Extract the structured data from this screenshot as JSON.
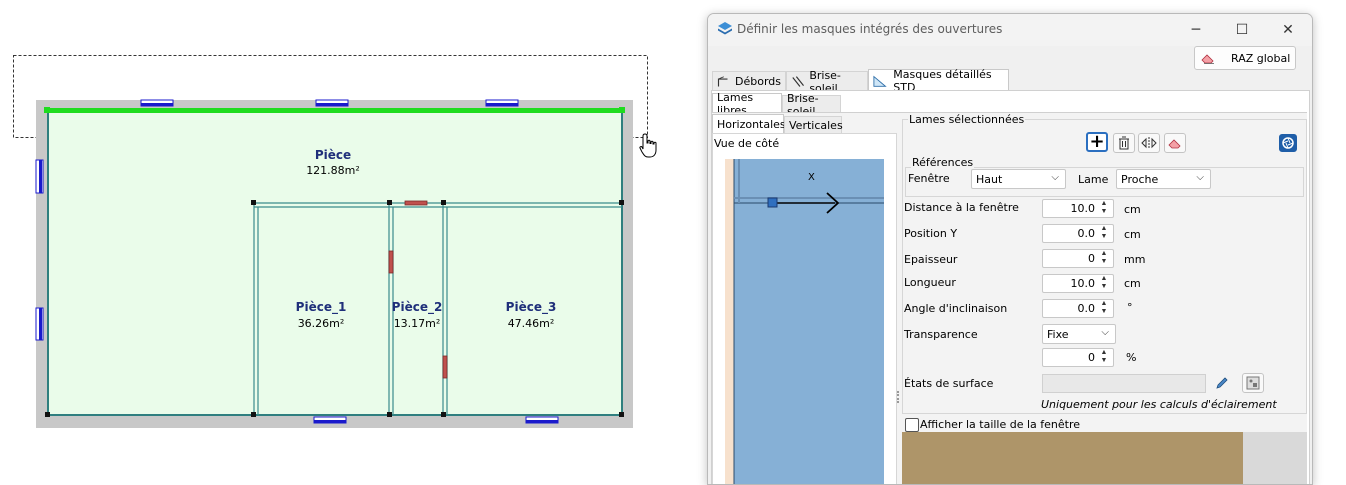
{
  "plan": {
    "rooms": [
      {
        "name": "Pièce",
        "area": "121.88m²"
      },
      {
        "name": "Pièce_1",
        "area": "36.26m²"
      },
      {
        "name": "Pièce_2",
        "area": "13.17m²"
      },
      {
        "name": "Pièce_3",
        "area": "47.46m²"
      }
    ]
  },
  "dialog": {
    "title": "Définir les masques intégrés des ouvertures",
    "window_controls": {
      "minimize": "─",
      "maximize": "☐",
      "close": "✕"
    },
    "raz_global": "RAZ global",
    "main_tabs": [
      "Débords",
      "Brise-soleil",
      "Masques détaillés STD"
    ],
    "sub_tabs": [
      "Lames libres",
      "Brise-soleil"
    ],
    "orientation_tabs": [
      "Horizontales",
      "Verticales"
    ],
    "side_view_label": "Vue de côté",
    "preview_axis_label": "X",
    "selected_group": "Lames sélectionnées",
    "references": {
      "title": "Références",
      "window_label": "Fenêtre",
      "window_value": "Haut",
      "blade_label": "Lame",
      "blade_value": "Proche"
    },
    "fields": [
      {
        "label": "Distance à la fenêtre",
        "value": "10.0",
        "unit": "cm"
      },
      {
        "label": "Position Y",
        "value": "0.0",
        "unit": "cm"
      },
      {
        "label": "Epaisseur",
        "value": "0",
        "unit": "mm"
      },
      {
        "label": "Longueur",
        "value": "10.0",
        "unit": "cm"
      },
      {
        "label": "Angle d'inclinaison",
        "value": "0.0",
        "unit": "°"
      }
    ],
    "transparence": {
      "label": "Transparence",
      "value": "Fixe",
      "percent_value": "0",
      "percent_unit": "%"
    },
    "surface_states_label": "États de surface",
    "lighting_note": "Uniquement pour les calculs d'éclairement",
    "show_window_size": "Afficher la taille de la fenêtre"
  }
}
